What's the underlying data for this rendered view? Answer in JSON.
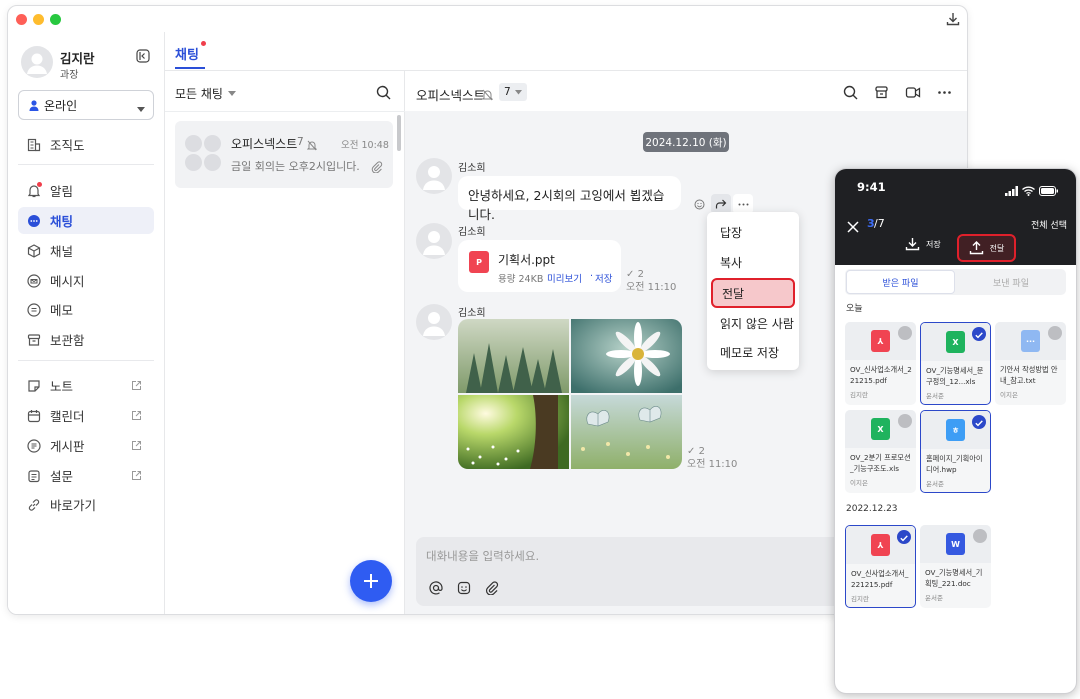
{
  "sidebar": {
    "user_name": "김지란",
    "user_title": "과장",
    "status": "온라인",
    "items": [
      {
        "label": "조직도"
      },
      {
        "label": "알림"
      },
      {
        "label": "채팅"
      },
      {
        "label": "채널"
      },
      {
        "label": "메시지"
      },
      {
        "label": "메모"
      },
      {
        "label": "보관함"
      },
      {
        "label": "노트"
      },
      {
        "label": "캘린더"
      },
      {
        "label": "게시판"
      },
      {
        "label": "설문"
      },
      {
        "label": "바로가기"
      }
    ]
  },
  "tabs": {
    "active": "채팅"
  },
  "list": {
    "filter": "모든 채팅",
    "rooms": [
      {
        "name": "오피스넥스트",
        "count": "7",
        "time": "오전 10:48",
        "preview": "금일 회의는 오후2시입니다."
      }
    ]
  },
  "chat": {
    "room_name": "오피스넥스트",
    "member_count": "7",
    "date_badge": "2024.12.10 (화)",
    "messages": [
      {
        "sender": "김소희",
        "text": "안녕하세요, 2시회의 고잉에서 뵙겠습니다."
      },
      {
        "sender": "김소희",
        "file_name": "기획서.ppt",
        "file_size": "용량 24KB",
        "preview": "미리보기",
        "save": "저장",
        "read": "2",
        "time": "오전 11:10"
      },
      {
        "sender": "김소희",
        "read": "2",
        "time": "오전 11:10"
      }
    ],
    "input_placeholder": "대화내용을 입력하세요.",
    "context_menu": [
      "답장",
      "복사",
      "전달",
      "읽지 않은 사람",
      "메모로 저장"
    ]
  },
  "phone": {
    "clock": "9:41",
    "counter_current": "3",
    "counter_total": "/7",
    "select_all": "전체 선택",
    "save": "저장",
    "forward": "전달",
    "tab_received": "받은 파일",
    "tab_sent": "보낸 파일",
    "section_today": "오늘",
    "section_date": "2022.12.23",
    "files_today": [
      {
        "name": "OV_신사업소개서_221215.pdf",
        "by": "김지란",
        "type": "pdf",
        "selected": false
      },
      {
        "name": "OV_기능명세서_문구정의_12...xls",
        "by": "윤서준",
        "type": "xls",
        "selected": true
      },
      {
        "name": "기안서 작성방법 안내_참고.txt",
        "by": "이지은",
        "type": "txt",
        "selected": false
      },
      {
        "name": "OV_2분기 프로모션_기능구조도.xls",
        "by": "이지은",
        "type": "xls",
        "selected": false
      },
      {
        "name": "홈페이지_기획아이디어.hwp",
        "by": "윤서준",
        "type": "hwp",
        "selected": true
      }
    ],
    "files_date": [
      {
        "name": "OV_신사업소개서_221215.pdf",
        "by": "김지란",
        "type": "pdf",
        "selected": true
      },
      {
        "name": "OV_기능명세서_기획팅_221.doc",
        "by": "윤서준",
        "type": "doc",
        "selected": false
      }
    ],
    "type_glyphs": {
      "pdf": "⅄",
      "xls": "X",
      "txt": "···",
      "hwp": "ㅎ",
      "doc": "W"
    },
    "colors": {
      "pdf": "#f04452",
      "xls": "#1fb35e",
      "txt": "#8fb8f2",
      "hwp": "#3d9df5",
      "doc": "#3559e0",
      "accent": "#2c48c9",
      "danger": "#e0202b"
    }
  }
}
